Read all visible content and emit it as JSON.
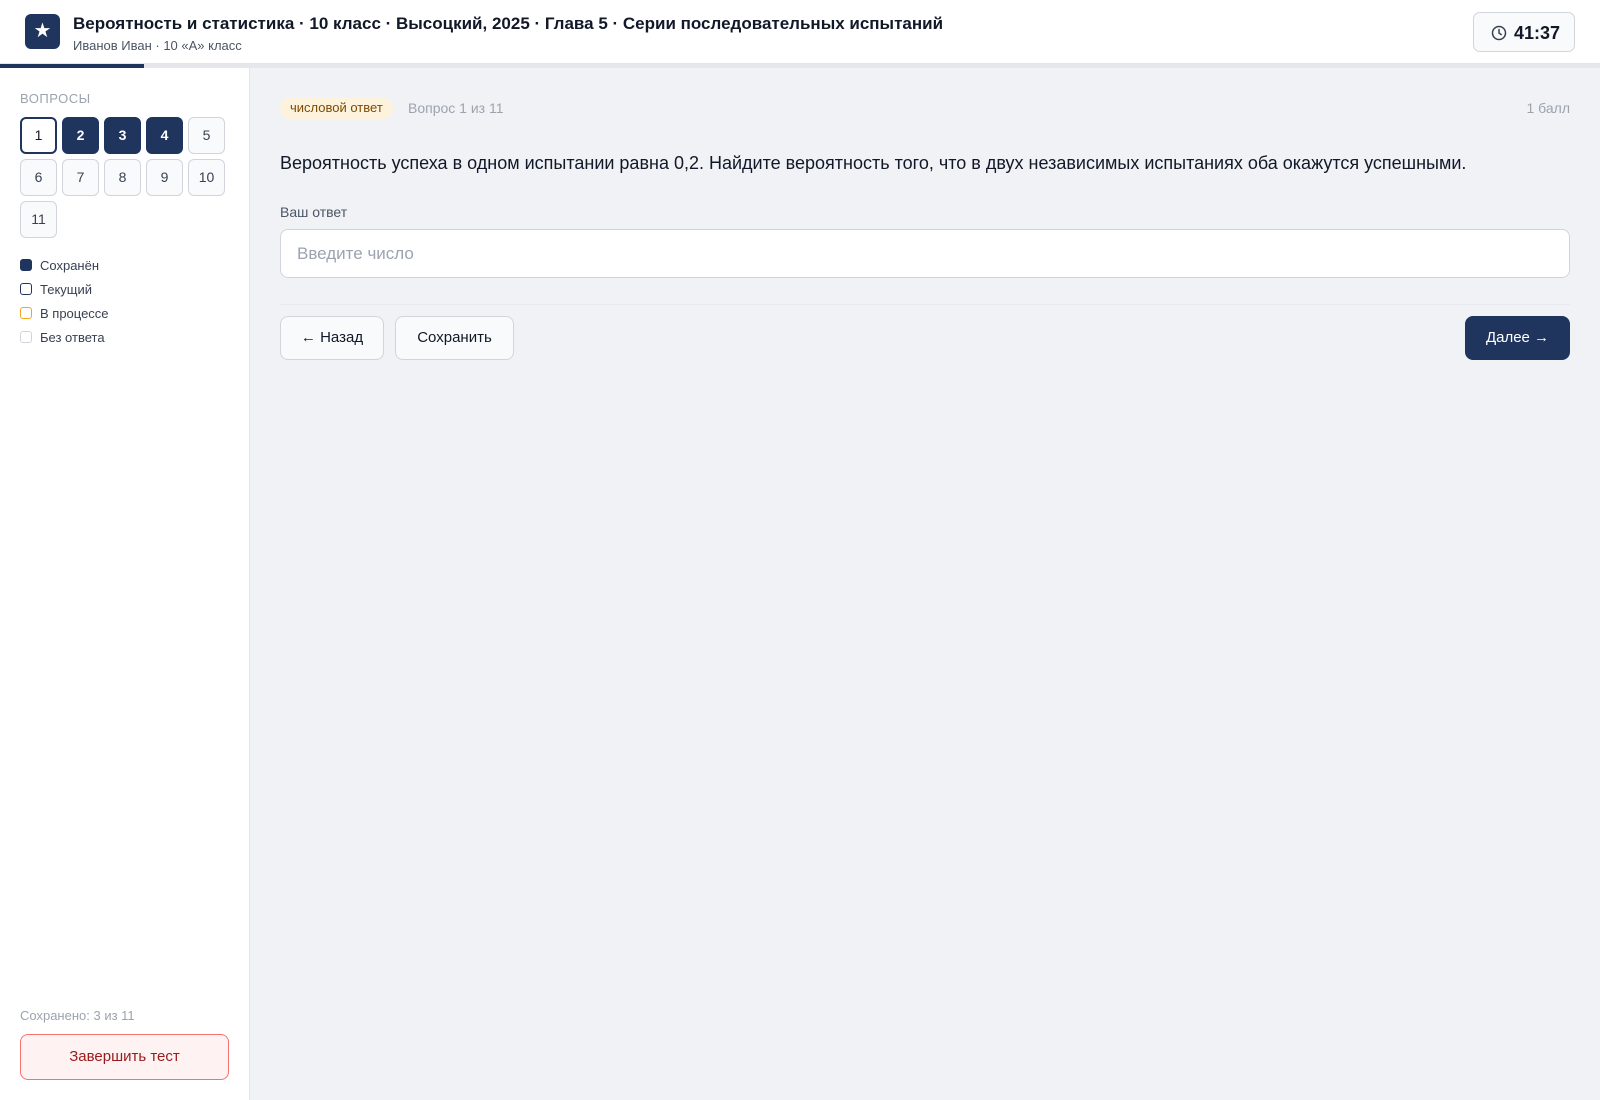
{
  "header": {
    "logo_icon": "star-icon",
    "title": "Вероятность и статистика · 10 класс · Высоцкий, 2025 · Глава 5 · Серии последовательных испытаний",
    "subtitle": "Иванов Иван · 10 «А» класс",
    "timer_icon": "clock-icon",
    "timer": "41:37",
    "progress_fraction": 0.09
  },
  "sidebar": {
    "heading": "ВОПРОСЫ",
    "questions": [
      {
        "label": "1",
        "state": "current"
      },
      {
        "label": "2",
        "state": "saved"
      },
      {
        "label": "3",
        "state": "saved"
      },
      {
        "label": "4",
        "state": "saved"
      },
      {
        "label": "5",
        "state": "empty"
      },
      {
        "label": "6",
        "state": "empty"
      },
      {
        "label": "7",
        "state": "empty"
      },
      {
        "label": "8",
        "state": "empty"
      },
      {
        "label": "9",
        "state": "empty"
      },
      {
        "label": "10",
        "state": "empty"
      },
      {
        "label": "11",
        "state": "empty"
      }
    ],
    "legend": [
      {
        "label": "Сохранён",
        "state": "saved"
      },
      {
        "label": "Текущий",
        "state": "current"
      },
      {
        "label": "В процессе",
        "state": "progress"
      },
      {
        "label": "Без ответа",
        "state": "empty"
      }
    ],
    "saved_count": "Сохранено: 3 из 11",
    "finish_label": "Завершить тест"
  },
  "colors": {
    "accent": "#1f355e",
    "in_progress": "#f5a524",
    "danger": "#991b1b"
  },
  "main": {
    "type_badge": "числовой ответ",
    "question_meta": "Вопрос 1 из 11",
    "points": "1 балл",
    "question_text": "Вероятность успеха в одном испытании равна 0,2. Найдите вероятность того, что в двух независимых испытаниях оба окажутся успешными.",
    "answer_label": "Ваш ответ",
    "answer_placeholder": "Введите число",
    "answer_value": "",
    "back_label": "← Назад",
    "save_label": "Сохранить",
    "next_label": "Далее →"
  }
}
